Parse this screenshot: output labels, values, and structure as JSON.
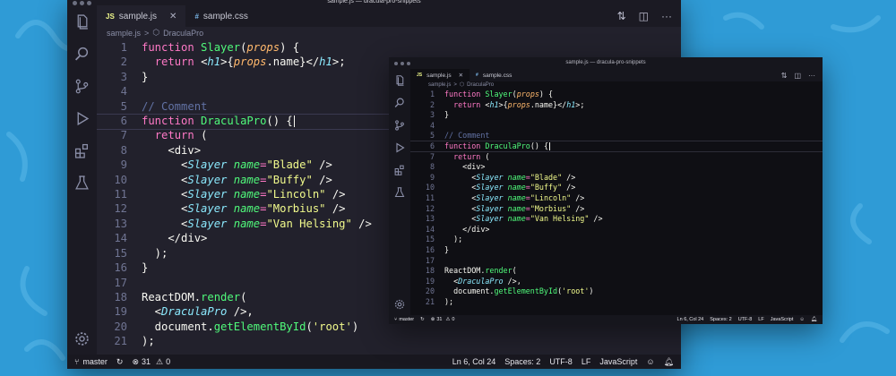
{
  "window_title": "sample.js — dracula-pro-snippets",
  "tabs": [
    {
      "lang": "JS",
      "label": "sample.js",
      "active": true
    },
    {
      "lang": "#",
      "label": "sample.css",
      "active": false
    }
  ],
  "breadcrumb": {
    "file": "sample.js",
    "separator": ">",
    "symbol": "DraculaPro"
  },
  "tab_actions": {
    "compare_icon": "compare-icon",
    "split_icon": "split-editor-icon",
    "more": "···"
  },
  "activity_icons": [
    "files-icon",
    "search-icon",
    "source-control-icon",
    "run-debug-icon",
    "extensions-icon",
    "testing-icon",
    "settings-gear-icon"
  ],
  "code_lines": [
    {
      "n": "1",
      "tokens": [
        [
          "kw",
          "function "
        ],
        [
          "fn",
          "Slayer"
        ],
        [
          "code",
          "("
        ],
        [
          "prop",
          "props"
        ],
        [
          "code",
          ") {"
        ]
      ]
    },
    {
      "n": "2",
      "tokens": [
        [
          "code",
          "  "
        ],
        [
          "kw",
          "return "
        ],
        [
          "code",
          "<"
        ],
        [
          "tag",
          "h1"
        ],
        [
          "code",
          ">{"
        ],
        [
          "prop",
          "props"
        ],
        [
          "code",
          ".name}</"
        ],
        [
          "tag",
          "h1"
        ],
        [
          "code",
          ">;"
        ]
      ]
    },
    {
      "n": "3",
      "tokens": [
        [
          "code",
          "}"
        ]
      ]
    },
    {
      "n": "4",
      "tokens": []
    },
    {
      "n": "5",
      "tokens": [
        [
          "cm",
          "// Comment"
        ]
      ]
    },
    {
      "n": "6",
      "tokens": [
        [
          "kw",
          "function "
        ],
        [
          "fn",
          "DraculaPro"
        ],
        [
          "code",
          "() {"
        ]
      ],
      "cursor": true
    },
    {
      "n": "7",
      "tokens": [
        [
          "code",
          "  "
        ],
        [
          "kw",
          "return "
        ],
        [
          "code",
          "("
        ]
      ]
    },
    {
      "n": "8",
      "tokens": [
        [
          "code",
          "    <"
        ],
        [
          "code",
          "div"
        ],
        [
          "code",
          ">"
        ]
      ]
    },
    {
      "n": "9",
      "tokens": [
        [
          "code",
          "      <"
        ],
        [
          "tag",
          "Slayer "
        ],
        [
          "attr",
          "name"
        ],
        [
          "punc",
          "="
        ],
        [
          "str",
          "\"Blade\""
        ],
        [
          "code",
          " />"
        ]
      ]
    },
    {
      "n": "10",
      "tokens": [
        [
          "code",
          "      <"
        ],
        [
          "tag",
          "Slayer "
        ],
        [
          "attr",
          "name"
        ],
        [
          "punc",
          "="
        ],
        [
          "str",
          "\"Buffy\""
        ],
        [
          "code",
          " />"
        ]
      ]
    },
    {
      "n": "11",
      "tokens": [
        [
          "code",
          "      <"
        ],
        [
          "tag",
          "Slayer "
        ],
        [
          "attr",
          "name"
        ],
        [
          "punc",
          "="
        ],
        [
          "str",
          "\"Lincoln\""
        ],
        [
          "code",
          " />"
        ]
      ]
    },
    {
      "n": "12",
      "tokens": [
        [
          "code",
          "      <"
        ],
        [
          "tag",
          "Slayer "
        ],
        [
          "attr",
          "name"
        ],
        [
          "punc",
          "="
        ],
        [
          "str",
          "\"Morbius\""
        ],
        [
          "code",
          " />"
        ]
      ]
    },
    {
      "n": "13",
      "tokens": [
        [
          "code",
          "      <"
        ],
        [
          "tag",
          "Slayer "
        ],
        [
          "attr",
          "name"
        ],
        [
          "punc",
          "="
        ],
        [
          "str",
          "\"Van Helsing\""
        ],
        [
          "code",
          " />"
        ]
      ]
    },
    {
      "n": "14",
      "tokens": [
        [
          "code",
          "    </"
        ],
        [
          "code",
          "div"
        ],
        [
          "code",
          ">"
        ]
      ]
    },
    {
      "n": "15",
      "tokens": [
        [
          "code",
          "  );"
        ]
      ]
    },
    {
      "n": "16",
      "tokens": [
        [
          "code",
          "}"
        ]
      ]
    },
    {
      "n": "17",
      "tokens": []
    },
    {
      "n": "18",
      "tokens": [
        [
          "code",
          "ReactDOM."
        ],
        [
          "fn",
          "render"
        ],
        [
          "code",
          "("
        ]
      ]
    },
    {
      "n": "19",
      "tokens": [
        [
          "code",
          "  <"
        ],
        [
          "tag",
          "DraculaPro"
        ],
        [
          "code",
          " />,"
        ]
      ]
    },
    {
      "n": "20",
      "tokens": [
        [
          "code",
          "  document."
        ],
        [
          "fn",
          "getElementById"
        ],
        [
          "code",
          "("
        ],
        [
          "str",
          "'root'"
        ],
        [
          "code",
          ")"
        ]
      ]
    },
    {
      "n": "21",
      "tokens": [
        [
          "code",
          ");"
        ]
      ]
    }
  ],
  "status": {
    "branch": "master",
    "errors": "31",
    "warnings": "0",
    "position": "Ln 6, Col 24",
    "spaces": "Spaces: 2",
    "encoding": "UTF-8",
    "eol": "LF",
    "language": "JavaScript"
  },
  "colors": {
    "background_blue": "#2f9bd6",
    "editor_bg": "#22212c",
    "editor_bg_alt": "#0f0f14",
    "keyword": "#ff79c6",
    "function": "#50fa7b",
    "string": "#f1fa8c",
    "tag": "#8be9fd",
    "comment": "#6272a4",
    "param": "#ffb86c"
  }
}
